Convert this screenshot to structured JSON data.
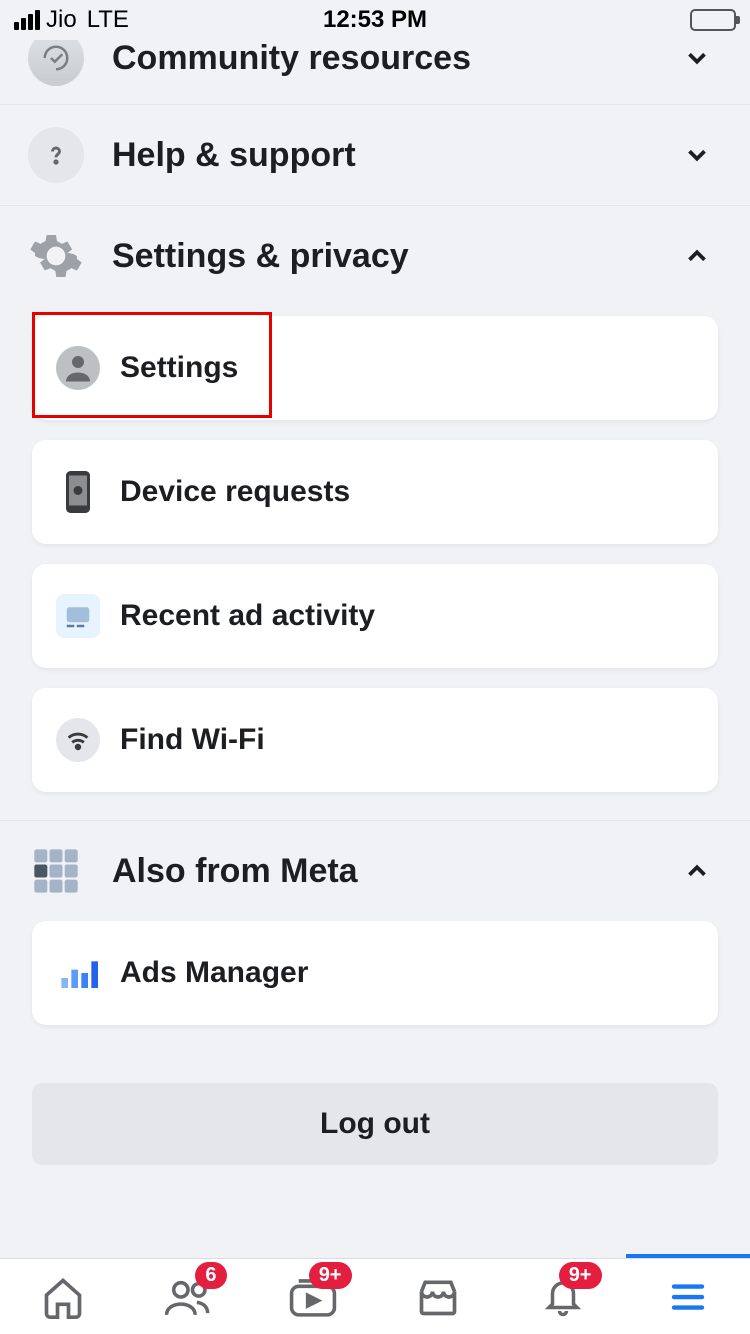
{
  "status": {
    "carrier": "Jio",
    "network": "LTE",
    "time": "12:53 PM"
  },
  "sections": {
    "community": {
      "label": "Community resources"
    },
    "help": {
      "label": "Help & support"
    },
    "settings_privacy": {
      "label": "Settings & privacy"
    },
    "also_from_meta": {
      "label": "Also from Meta"
    }
  },
  "settings_items": {
    "settings": "Settings",
    "device_requests": "Device requests",
    "recent_ad": "Recent ad activity",
    "find_wifi": "Find Wi-Fi"
  },
  "meta_items": {
    "ads_manager": "Ads Manager"
  },
  "logout_label": "Log out",
  "nav_badges": {
    "friends": "6",
    "watch": "9+",
    "notifications": "9+"
  }
}
